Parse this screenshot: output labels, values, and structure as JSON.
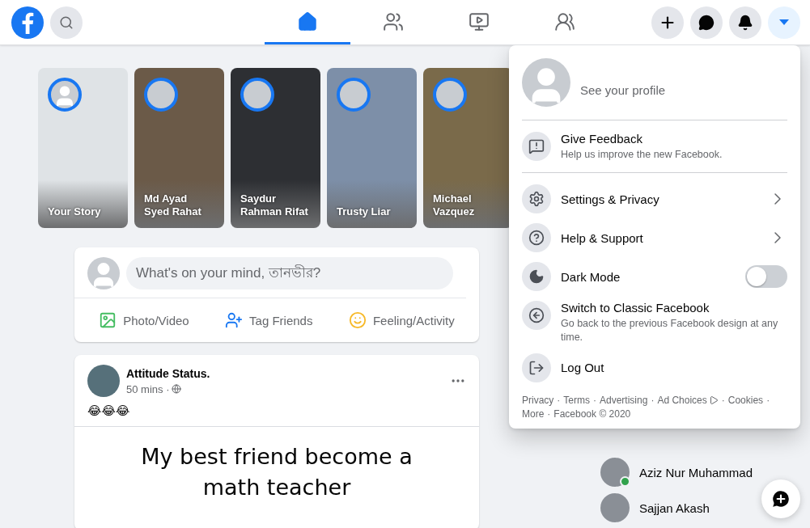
{
  "topbar": {
    "nav_tabs": [
      {
        "kind": "home",
        "selected": true
      },
      {
        "kind": "friends",
        "selected": false
      },
      {
        "kind": "watch",
        "selected": false
      },
      {
        "kind": "groups",
        "selected": false
      }
    ],
    "actions": [
      {
        "kind": "create",
        "selected": false
      },
      {
        "kind": "messenger",
        "selected": false
      },
      {
        "kind": "notifications",
        "selected": false
      },
      {
        "kind": "account",
        "selected": true
      }
    ]
  },
  "stories": [
    {
      "kind": "own",
      "name": "Your Story",
      "color": "#dfe3e6"
    },
    {
      "kind": "friend",
      "name": "Md Ayad Syed Rahat",
      "color": "#6b5a48"
    },
    {
      "kind": "friend",
      "name": "Saydur Rahman Rifat",
      "color": "#2d2f33"
    },
    {
      "kind": "friend",
      "name": "Trusty Liar",
      "color": "#7d8fa8"
    },
    {
      "kind": "friend",
      "name": "Michael Vazquez",
      "color": "#7a6a4a"
    }
  ],
  "composer": {
    "placeholder": "What's on your mind, তানভীর?",
    "actions": [
      {
        "kind": "photo",
        "label": "Photo/Video"
      },
      {
        "kind": "tag",
        "label": "Tag Friends"
      },
      {
        "kind": "feeling",
        "label": "Feeling/Activity"
      }
    ]
  },
  "post": {
    "author": "Attitude Status.",
    "time": "50 mins ·",
    "text": "😂😂😂",
    "image_text": "My best friend become a math teacher"
  },
  "menu": {
    "profile": {
      "subtitle": "See your profile"
    },
    "items": [
      {
        "kind": "feedback",
        "title": "Give Feedback",
        "subtitle": "Help us improve the new Facebook."
      },
      {
        "kind": "settings",
        "title": "Settings & Privacy",
        "chevron": true
      },
      {
        "kind": "help",
        "title": "Help & Support",
        "chevron": true
      },
      {
        "kind": "darkmode",
        "title": "Dark Mode",
        "on": false
      },
      {
        "kind": "classic",
        "title": "Switch to Classic Facebook",
        "subtitle": "Go back to the previous Facebook design at any time."
      },
      {
        "kind": "logout",
        "title": "Log Out"
      }
    ],
    "footer_separator": "·",
    "footer_links": [
      {
        "label": "Privacy"
      },
      {
        "label": "Terms"
      },
      {
        "label": "Advertising"
      },
      {
        "label": "Ad Choices",
        "icon": true
      },
      {
        "label": "Cookies"
      },
      {
        "label": "More"
      },
      {
        "label": "Facebook © 2020"
      }
    ]
  },
  "contacts": [
    {
      "name": "Aziz Nur Muhammad",
      "online": true
    },
    {
      "name": "Sajjan Akash",
      "online": false
    }
  ]
}
